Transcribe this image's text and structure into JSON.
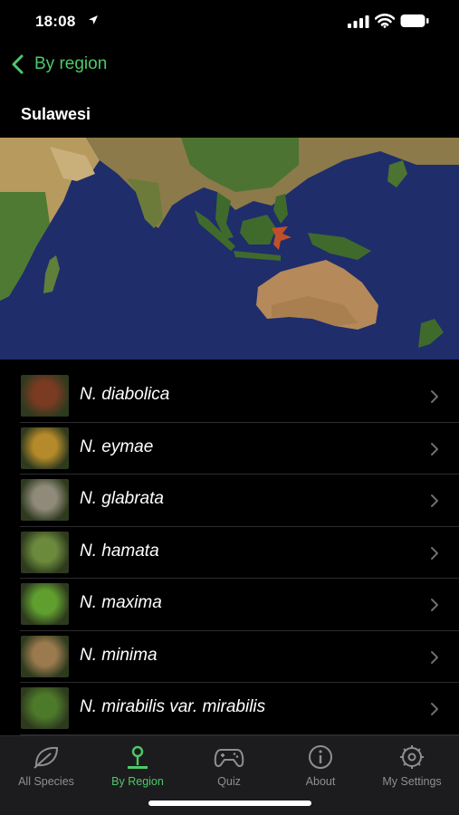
{
  "status": {
    "time": "18:08"
  },
  "nav": {
    "back_label": "By region"
  },
  "page": {
    "title": "Sulawesi"
  },
  "species": [
    {
      "name": "N. diabolica",
      "thumb_color": "#7a3b22"
    },
    {
      "name": "N. eymae",
      "thumb_color": "#b58a2a"
    },
    {
      "name": "N. glabrata",
      "thumb_color": "#8f8a7a"
    },
    {
      "name": "N. hamata",
      "thumb_color": "#6c8a3c"
    },
    {
      "name": "N. maxima",
      "thumb_color": "#5f9e2f"
    },
    {
      "name": "N. minima",
      "thumb_color": "#9a7a4e"
    },
    {
      "name": "N. mirabilis var. mirabilis",
      "thumb_color": "#4d7a2a"
    }
  ],
  "tabs": [
    {
      "label": "All Species",
      "icon": "leaf-icon",
      "active": false
    },
    {
      "label": "By Region",
      "icon": "map-pin-icon",
      "active": true
    },
    {
      "label": "Quiz",
      "icon": "gamepad-icon",
      "active": false
    },
    {
      "label": "About",
      "icon": "info-icon",
      "active": false
    },
    {
      "label": "My Settings",
      "icon": "gear-icon",
      "active": false
    }
  ],
  "colors": {
    "accent": "#4fc86a",
    "background": "#000000",
    "tab_bar": "#1c1c1e",
    "inactive": "#8e8e93",
    "region_highlight": "#c0502a"
  }
}
